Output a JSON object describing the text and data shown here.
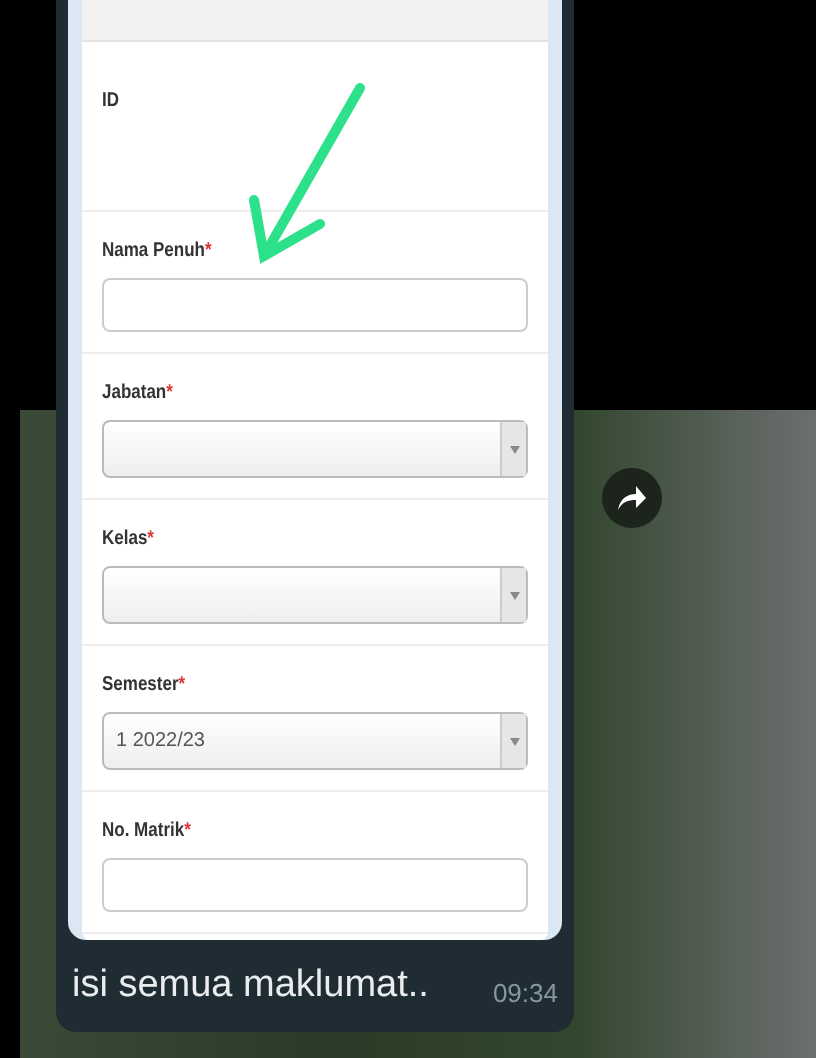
{
  "form": {
    "fields": [
      {
        "label": "ID",
        "kind": "text-only"
      },
      {
        "label": "Nama Penuh",
        "required_mark": "*",
        "kind": "input"
      },
      {
        "label": "Jabatan",
        "required_mark": "*",
        "kind": "select"
      },
      {
        "label": "Kelas",
        "required_mark": "*",
        "kind": "select"
      },
      {
        "label": "Semester",
        "required_mark": "*",
        "kind": "select",
        "value": "1 2022/23"
      },
      {
        "label": "No. Matrik",
        "required_mark": "*",
        "kind": "input"
      }
    ]
  },
  "message": {
    "caption": "isi semua maklumat..",
    "time": "09:34"
  }
}
